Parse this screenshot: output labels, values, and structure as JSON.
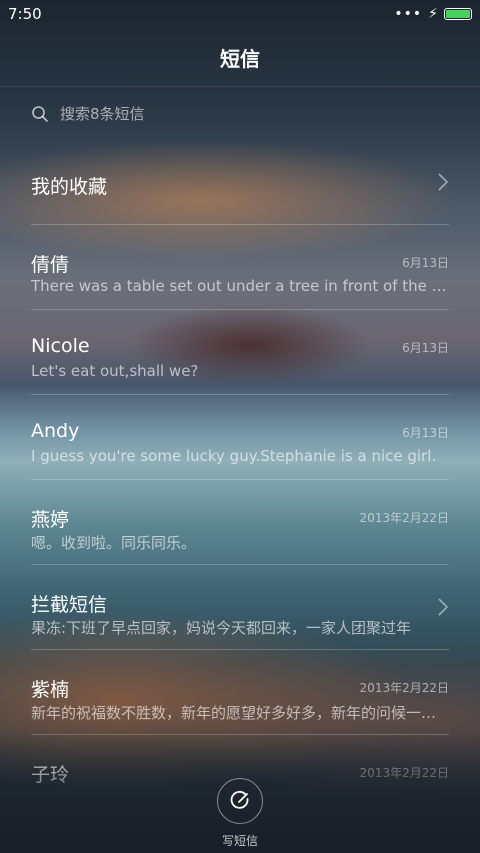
{
  "status_bar": {
    "time": "7:50",
    "more_dots": "•••",
    "bolt": "⚡",
    "battery_color": "#45d15a"
  },
  "header": {
    "title": "短信"
  },
  "search": {
    "placeholder": "搜索8条短信"
  },
  "conversations": [
    {
      "name": "我的收藏",
      "date": "",
      "preview": ""
    },
    {
      "name": "倩倩",
      "date": "6月13日",
      "preview": "There was a table set out under a tree in front of the house"
    },
    {
      "name": "Nicole",
      "date": "6月13日",
      "preview": "Let's eat out,shall we?"
    },
    {
      "name": "Andy",
      "date": "6月13日",
      "preview": "I guess you're some lucky guy.Stephanie is a nice girl."
    },
    {
      "name": "燕婷",
      "date": "2013年2月22日",
      "preview": "嗯。收到啦。同乐同乐。"
    },
    {
      "name": "拦截短信",
      "date": "",
      "preview": "果冻:下班了早点回家，妈说今天都回来，一家人团聚过年"
    },
    {
      "name": "紫楠",
      "date": "2013年2月22日",
      "preview": "新年的祝福数不胜数，新年的愿望好多好多，新年的问候一声声"
    },
    {
      "name": "子玲",
      "date": "2013年2月22日",
      "preview": ""
    }
  ],
  "compose": {
    "label": "写短信"
  }
}
